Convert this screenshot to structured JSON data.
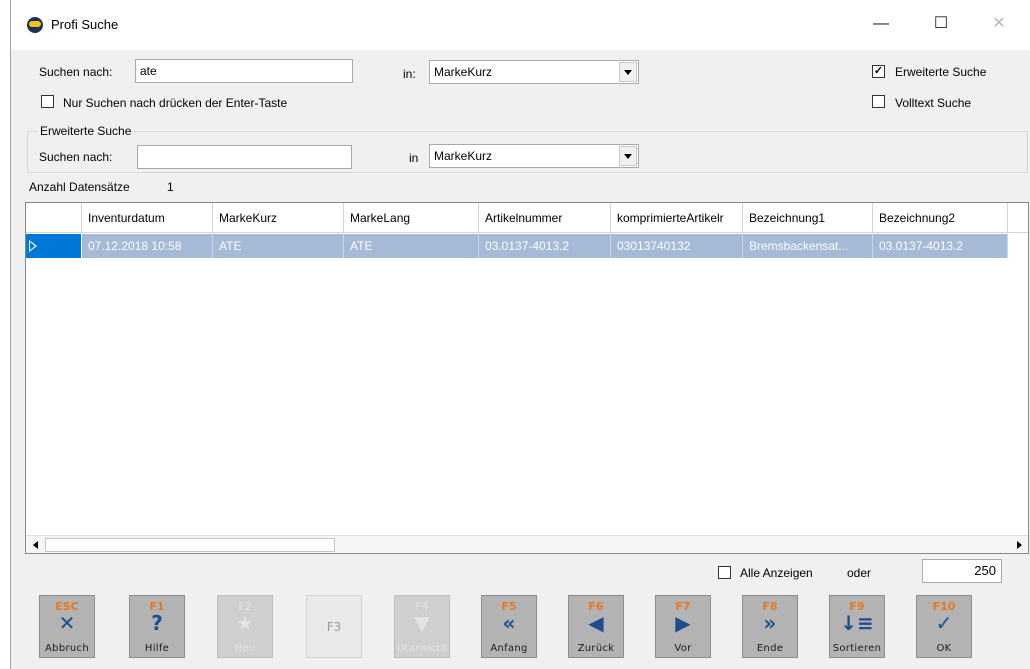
{
  "window": {
    "title": "Profi Suche",
    "minimize": "—",
    "maximize": "☐",
    "close": "✕"
  },
  "search": {
    "label": "Suchen nach:",
    "value": "ate",
    "in_label": "in:",
    "field": "MarkeKurz",
    "enter_only_label": "Nur Suchen nach drücken der Enter-Taste",
    "enter_only_checked": false,
    "extended_label": "Erweiterte Suche",
    "extended_checked": true,
    "fulltext_label": "Volltext Suche",
    "fulltext_checked": false
  },
  "extended": {
    "group_title": "Erweiterte Suche",
    "label": "Suchen nach:",
    "value": "",
    "in_label": "in",
    "field": "MarkeKurz"
  },
  "count": {
    "label": "Anzahl Datensätze",
    "value": "1"
  },
  "grid": {
    "columns": [
      "Inventurdatum",
      "MarkeKurz",
      "MarkeLang",
      "Artikelnummer",
      "komprimierteArtikelr",
      "Bezeichnung1",
      "Bezeichnung2"
    ],
    "rows": [
      {
        "Inventurdatum": "07.12.2018 10:58",
        "MarkeKurz": "ATE",
        "MarkeLang": "ATE",
        "Artikelnummer": "03.0137-4013.2",
        "komprimierteArtikelr": "03013740132",
        "Bezeichnung1": "Bremsbackensat...",
        "Bezeichnung2": "03.0137-4013.2"
      }
    ]
  },
  "footer": {
    "show_all_label": "Alle Anzeigen",
    "show_all_checked": false,
    "or_label": "oder",
    "limit_value": "250"
  },
  "buttons": [
    {
      "key": "ESC",
      "label": "Abbruch",
      "icon": "x-icon",
      "enabled": true
    },
    {
      "key": "F1",
      "label": "Hilfe",
      "icon": "question-icon",
      "enabled": true
    },
    {
      "key": "F2",
      "label": "Neu",
      "icon": "new-record-icon",
      "enabled": false
    },
    {
      "key": "",
      "label": "F3",
      "icon": "",
      "enabled": false
    },
    {
      "key": "F4",
      "label": "Uransicht",
      "icon": "double-chevron-down-icon",
      "enabled": false
    },
    {
      "key": "F5",
      "label": "Anfang",
      "icon": "first-icon",
      "enabled": true
    },
    {
      "key": "F6",
      "label": "Zurück",
      "icon": "previous-icon",
      "enabled": true
    },
    {
      "key": "F7",
      "label": "Vor",
      "icon": "next-icon",
      "enabled": true
    },
    {
      "key": "F8",
      "label": "Ende",
      "icon": "last-icon",
      "enabled": true
    },
    {
      "key": "F9",
      "label": "Sortieren",
      "icon": "sort-icon",
      "enabled": true
    },
    {
      "key": "F10",
      "label": "OK",
      "icon": "checkmark-icon",
      "enabled": true
    }
  ]
}
